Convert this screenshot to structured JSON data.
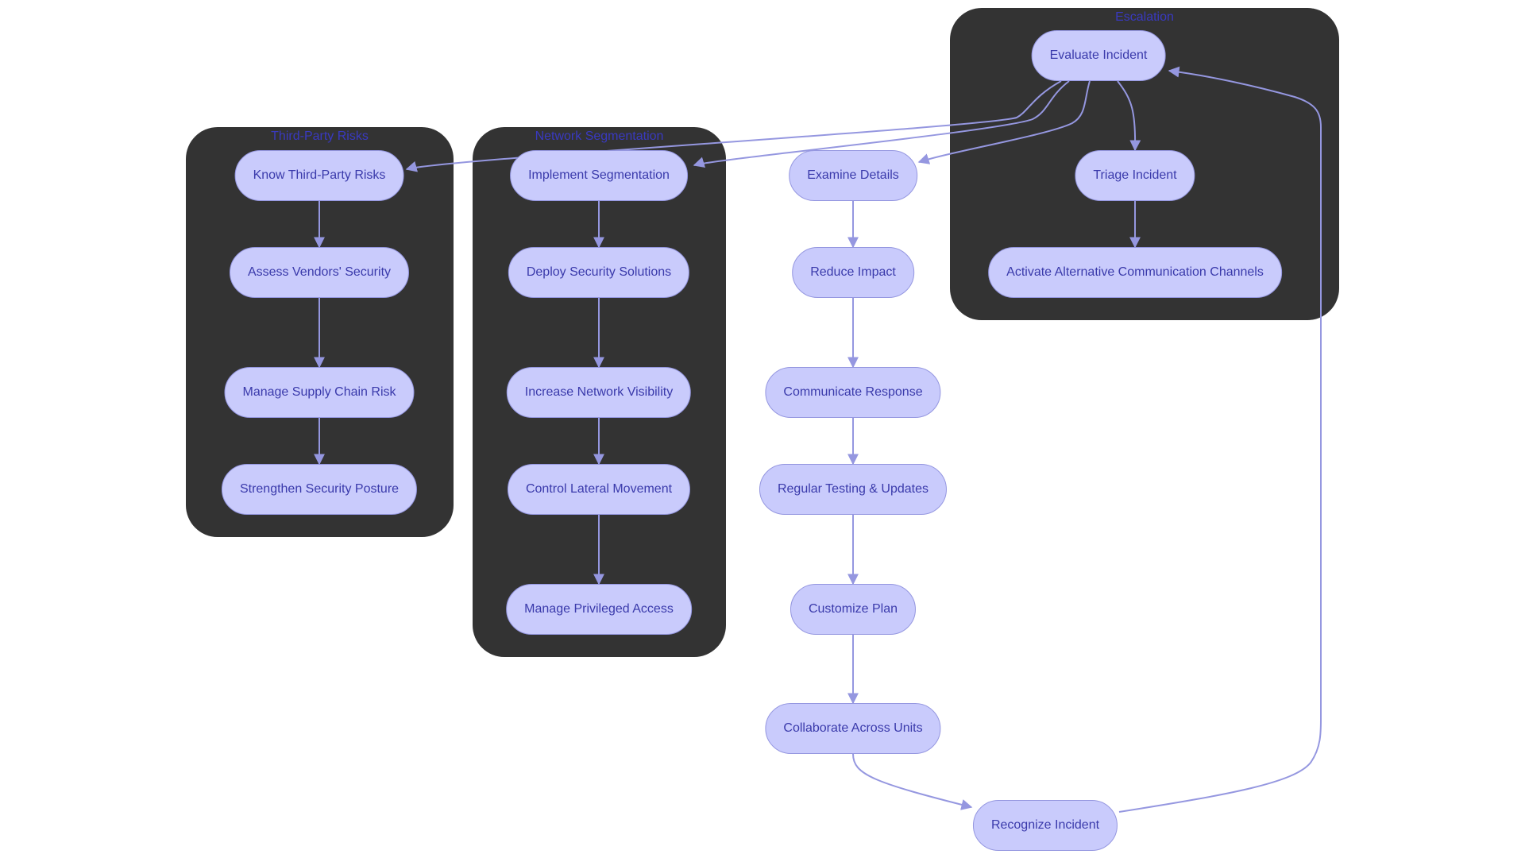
{
  "diagram": {
    "type": "flowchart",
    "colors": {
      "node_fill": "#c9cbfc",
      "node_border": "#9597e0",
      "node_text": "#3a3aab",
      "cluster_fill": "#333333",
      "cluster_title": "#3939c0",
      "edge": "#9597e0"
    },
    "clusters": [
      {
        "id": "escalation",
        "title": "Escalation"
      },
      {
        "id": "third_party",
        "title": "Third-Party Risks"
      },
      {
        "id": "network_seg",
        "title": "Network Segmentation"
      }
    ],
    "nodes": [
      {
        "id": "evaluate",
        "label": "Evaluate Incident",
        "cluster": "escalation"
      },
      {
        "id": "triage",
        "label": "Triage Incident",
        "cluster": "escalation"
      },
      {
        "id": "activate",
        "label": "Activate Alternative Communication Channels",
        "cluster": "escalation"
      },
      {
        "id": "know_tp",
        "label": "Know Third-Party Risks",
        "cluster": "third_party"
      },
      {
        "id": "assess",
        "label": "Assess Vendors' Security",
        "cluster": "third_party"
      },
      {
        "id": "supply",
        "label": "Manage Supply Chain Risk",
        "cluster": "third_party"
      },
      {
        "id": "posture",
        "label": "Strengthen Security Posture",
        "cluster": "third_party"
      },
      {
        "id": "implement",
        "label": "Implement Segmentation",
        "cluster": "network_seg"
      },
      {
        "id": "deploy",
        "label": "Deploy Security Solutions",
        "cluster": "network_seg"
      },
      {
        "id": "visibility",
        "label": "Increase Network Visibility",
        "cluster": "network_seg"
      },
      {
        "id": "lateral",
        "label": "Control Lateral Movement",
        "cluster": "network_seg"
      },
      {
        "id": "privileged",
        "label": "Manage Privileged Access",
        "cluster": "network_seg"
      },
      {
        "id": "examine",
        "label": "Examine Details",
        "cluster": null
      },
      {
        "id": "reduce",
        "label": "Reduce Impact",
        "cluster": null
      },
      {
        "id": "communicate",
        "label": "Communicate Response",
        "cluster": null
      },
      {
        "id": "testing",
        "label": "Regular Testing & Updates",
        "cluster": null
      },
      {
        "id": "customize",
        "label": "Customize Plan",
        "cluster": null
      },
      {
        "id": "collaborate",
        "label": "Collaborate Across Units",
        "cluster": null
      },
      {
        "id": "recognize",
        "label": "Recognize Incident",
        "cluster": null
      }
    ],
    "edges": [
      {
        "from": "evaluate",
        "to": "know_tp"
      },
      {
        "from": "evaluate",
        "to": "implement"
      },
      {
        "from": "evaluate",
        "to": "examine"
      },
      {
        "from": "evaluate",
        "to": "triage"
      },
      {
        "from": "triage",
        "to": "activate"
      },
      {
        "from": "know_tp",
        "to": "assess"
      },
      {
        "from": "assess",
        "to": "supply"
      },
      {
        "from": "supply",
        "to": "posture"
      },
      {
        "from": "implement",
        "to": "deploy"
      },
      {
        "from": "deploy",
        "to": "visibility"
      },
      {
        "from": "visibility",
        "to": "lateral"
      },
      {
        "from": "lateral",
        "to": "privileged"
      },
      {
        "from": "examine",
        "to": "reduce"
      },
      {
        "from": "reduce",
        "to": "communicate"
      },
      {
        "from": "communicate",
        "to": "testing"
      },
      {
        "from": "testing",
        "to": "customize"
      },
      {
        "from": "customize",
        "to": "collaborate"
      },
      {
        "from": "collaborate",
        "to": "recognize"
      },
      {
        "from": "recognize",
        "to": "evaluate"
      }
    ]
  }
}
